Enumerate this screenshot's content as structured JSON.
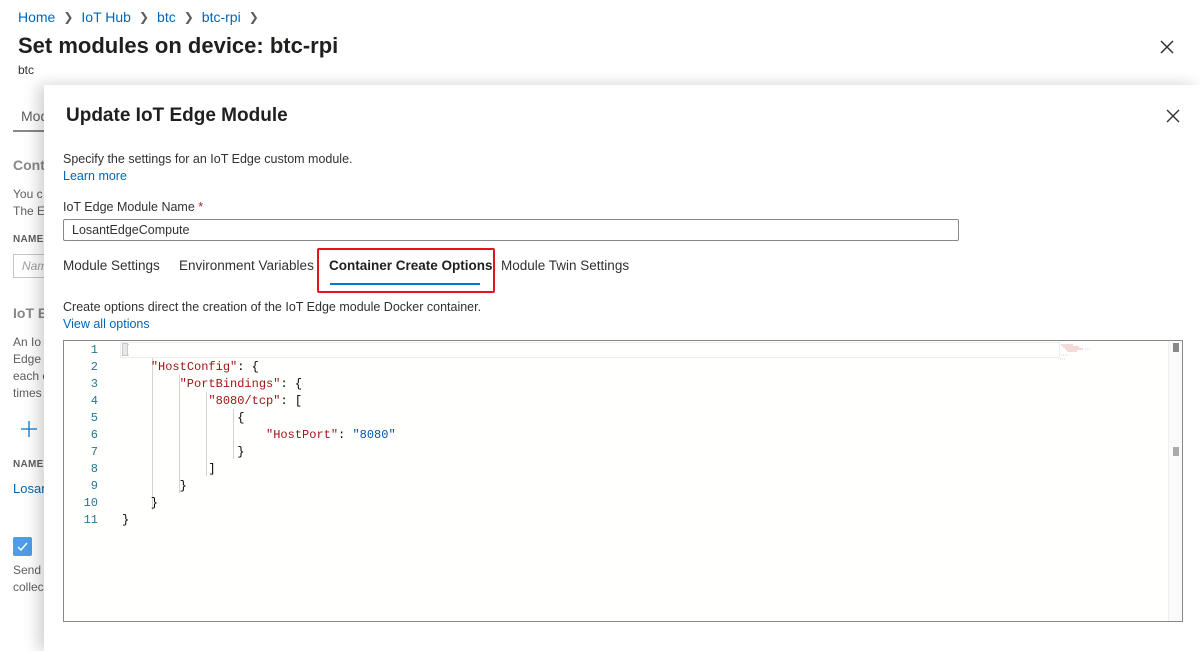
{
  "breadcrumb": {
    "items": [
      "Home",
      "IoT Hub",
      "btc",
      "btc-rpi"
    ]
  },
  "page": {
    "title": "Set modules on device: btc-rpi",
    "subtitle": "btc"
  },
  "background": {
    "tab": "Mod",
    "heading1": "Cont",
    "text1": "You c",
    "text2": "The E",
    "label_name": "NAME",
    "input_placeholder": "Nam",
    "heading2": "IoT E",
    "text3": "An Io",
    "text4": "Edge",
    "text5": "each c",
    "text6": "times",
    "label_name2": "NAME",
    "link": "Losan",
    "text7": "Send",
    "text8": "collec"
  },
  "panel": {
    "title": "Update IoT Edge Module",
    "description": "Specify the settings for an IoT Edge custom module.",
    "learn_more": "Learn more",
    "field_label": "IoT Edge Module Name",
    "required_mark": "*",
    "module_name_value": "LosantEdgeCompute",
    "tabs": [
      {
        "label": "Module Settings"
      },
      {
        "label": "Environment Variables"
      },
      {
        "label": "Container Create Options"
      },
      {
        "label": "Module Twin Settings"
      }
    ],
    "active_tab": "Container Create Options",
    "create_description": "Create options direct the creation of the IoT Edge module Docker container.",
    "view_all_options": "View all options"
  },
  "editor": {
    "line_numbers": [
      "1",
      "2",
      "3",
      "4",
      "5",
      "6",
      "7",
      "8",
      "9",
      "10",
      "11"
    ],
    "lines": [
      [
        {
          "t": "p",
          "v": "{"
        }
      ],
      [
        {
          "t": "p",
          "v": "    "
        },
        {
          "t": "k",
          "v": "\"HostConfig\""
        },
        {
          "t": "p",
          "v": ": {"
        }
      ],
      [
        {
          "t": "p",
          "v": "        "
        },
        {
          "t": "k",
          "v": "\"PortBindings\""
        },
        {
          "t": "p",
          "v": ": {"
        }
      ],
      [
        {
          "t": "p",
          "v": "            "
        },
        {
          "t": "k",
          "v": "\"8080/tcp\""
        },
        {
          "t": "p",
          "v": ": ["
        }
      ],
      [
        {
          "t": "p",
          "v": "                {"
        }
      ],
      [
        {
          "t": "p",
          "v": "                    "
        },
        {
          "t": "k",
          "v": "\"HostPort\""
        },
        {
          "t": "p",
          "v": ": "
        },
        {
          "t": "s",
          "v": "\"8080\""
        }
      ],
      [
        {
          "t": "p",
          "v": "                }"
        }
      ],
      [
        {
          "t": "p",
          "v": "            ]"
        }
      ],
      [
        {
          "t": "p",
          "v": "        }"
        }
      ],
      [
        {
          "t": "p",
          "v": "    }"
        }
      ],
      [
        {
          "t": "p",
          "v": "}"
        }
      ]
    ]
  },
  "colors": {
    "link": "#0067b8",
    "accent": "#0078d4",
    "highlight": "#e81123",
    "json_key": "#a31515",
    "json_string": "#0451a5",
    "line_number": "#237893"
  },
  "icons": {
    "page_close": "close-icon",
    "panel_close": "close-icon",
    "add": "plus-icon",
    "checkbox": "checkmark-icon"
  }
}
